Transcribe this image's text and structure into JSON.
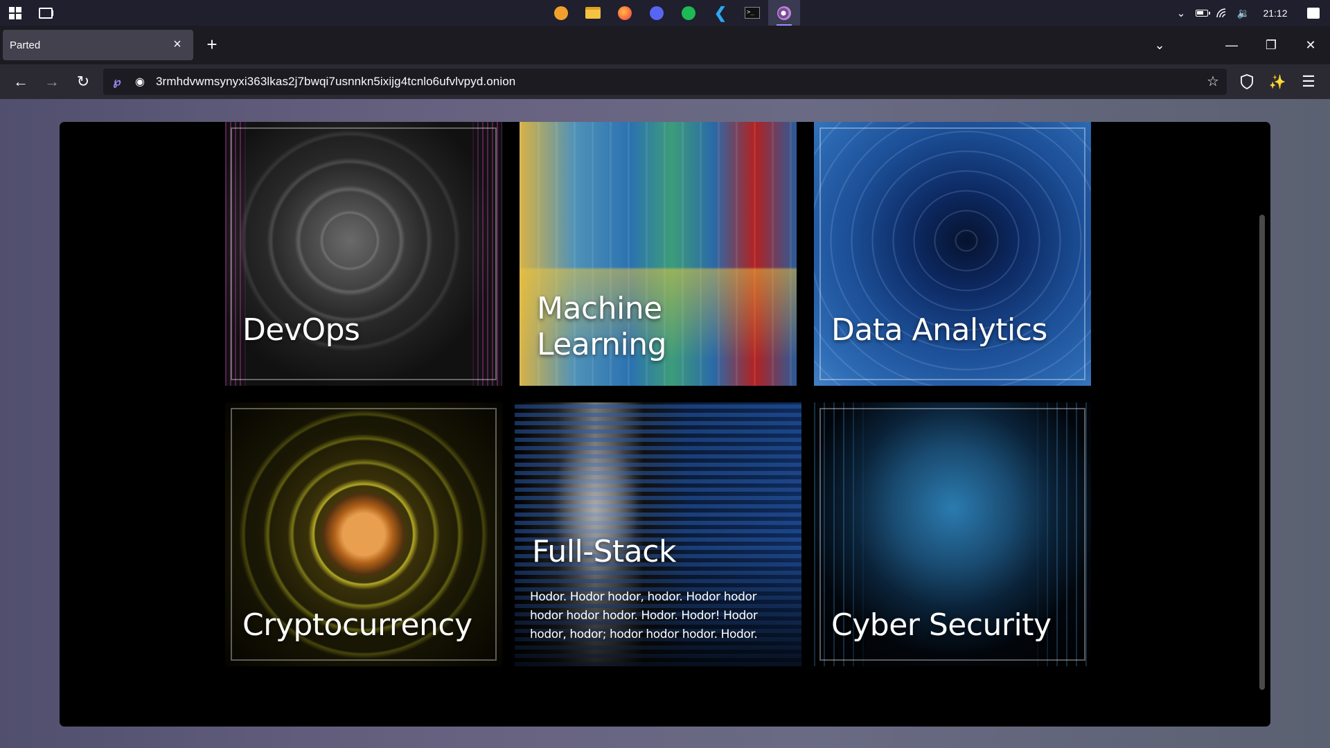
{
  "taskbar": {
    "start_icon": "windows-start-icon",
    "task_view_icon": "task-view-icon",
    "pinned_apps": [
      {
        "name": "brave-icon",
        "color": "#f2a02c"
      },
      {
        "name": "file-explorer-icon",
        "color": "#f5c342"
      },
      {
        "name": "firefox-icon",
        "color": "#ff7139"
      },
      {
        "name": "discord-icon",
        "color": "#5865f2"
      },
      {
        "name": "spotify-icon",
        "color": "#1db954"
      },
      {
        "name": "vscode-icon",
        "color": "#2ea7f2"
      },
      {
        "name": "terminal-icon",
        "color": "#111111"
      },
      {
        "name": "tor-browser-icon",
        "color": "#7d4698"
      }
    ],
    "clock": "21:12"
  },
  "browser": {
    "tab_title": "Parted",
    "url": "3rmhdvwmsynyxi363lkas2j7bwqi7usnnkn5ixijg4tcnlo6ufvlvpyd.onion",
    "url_prefix_icon": "tor-onion-icon"
  },
  "page": {
    "cards": [
      {
        "title": "DevOps",
        "image": "devops-circuit-image"
      },
      {
        "title": "Machine Learning",
        "image": "machine-learning-city-image"
      },
      {
        "title": "Data Analytics",
        "image": "binary-tunnel-image"
      },
      {
        "title": "Cryptocurrency",
        "image": "bitcoin-image"
      },
      {
        "title": "Full-Stack",
        "image": "woman-binary-image",
        "description": "Hodor. Hodor hodor, hodor. Hodor hodor hodor hodor hodor. Hodor. Hodor! Hodor hodor, hodor; hodor hodor hodor. Hodor."
      },
      {
        "title": "Cyber Security",
        "image": "hooded-globe-image"
      }
    ]
  }
}
